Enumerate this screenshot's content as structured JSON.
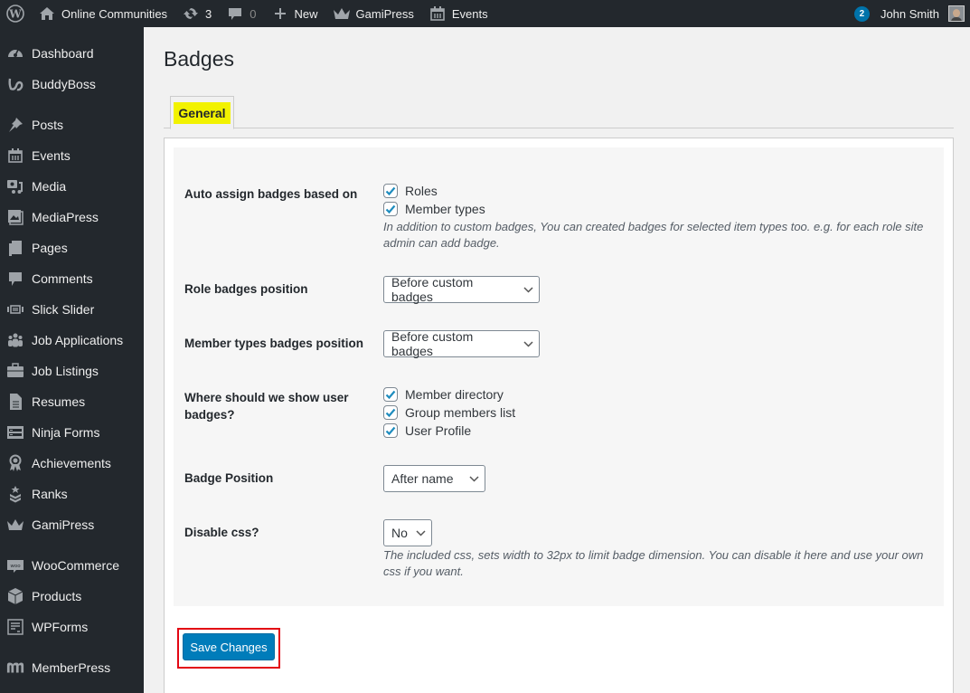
{
  "adminbar": {
    "wp_logo": "wordpress-logo-icon",
    "site_name": "Online Communities",
    "updates_count": "3",
    "comments_count": "0",
    "new_label": "New",
    "gamipress_label": "GamiPress",
    "events_label": "Events",
    "notifications_count": "2",
    "user_name": "John Smith"
  },
  "sidebar": {
    "items": [
      {
        "label": "Dashboard",
        "icon": "dashboard-icon"
      },
      {
        "label": "BuddyBoss",
        "icon": "buddyboss-icon"
      },
      {
        "label": "Posts",
        "icon": "pin-icon"
      },
      {
        "label": "Events",
        "icon": "calendar-icon"
      },
      {
        "label": "Media",
        "icon": "media-icon"
      },
      {
        "label": "MediaPress",
        "icon": "gallery-icon"
      },
      {
        "label": "Pages",
        "icon": "pages-icon"
      },
      {
        "label": "Comments",
        "icon": "comment-icon"
      },
      {
        "label": "Slick Slider",
        "icon": "slider-icon"
      },
      {
        "label": "Job Applications",
        "icon": "groups-icon"
      },
      {
        "label": "Job Listings",
        "icon": "briefcase-icon"
      },
      {
        "label": "Resumes",
        "icon": "document-icon"
      },
      {
        "label": "Ninja Forms",
        "icon": "form-icon"
      },
      {
        "label": "Achievements",
        "icon": "award-icon"
      },
      {
        "label": "Ranks",
        "icon": "rank-icon"
      },
      {
        "label": "GamiPress",
        "icon": "crown-icon"
      },
      {
        "label": "WooCommerce",
        "icon": "woo-icon"
      },
      {
        "label": "Products",
        "icon": "box-icon"
      },
      {
        "label": "WPForms",
        "icon": "wpforms-icon"
      },
      {
        "label": "MemberPress",
        "icon": "memberpress-icon"
      }
    ]
  },
  "page": {
    "title": "Badges",
    "tabs": [
      {
        "label": "General",
        "active": true
      }
    ]
  },
  "settings": {
    "auto_assign": {
      "label": "Auto assign badges based on",
      "options": [
        {
          "label": "Roles",
          "checked": true
        },
        {
          "label": "Member types",
          "checked": true
        }
      ],
      "description": "In addition to custom badges, You can created badges for selected item types too. e.g. for each role site admin can add badge."
    },
    "role_position": {
      "label": "Role badges position",
      "value": "Before custom badges"
    },
    "member_types_position": {
      "label": "Member types badges position",
      "value": "Before custom badges"
    },
    "show_where": {
      "label": "Where should we show user badges?",
      "options": [
        {
          "label": "Member directory",
          "checked": true
        },
        {
          "label": "Group members list",
          "checked": true
        },
        {
          "label": "User Profile",
          "checked": true
        }
      ]
    },
    "badge_position": {
      "label": "Badge Position",
      "value": "After name"
    },
    "disable_css": {
      "label": "Disable css?",
      "value": "No",
      "description": "The included css, sets width to 32px to limit badge dimension. You can disable it here and use your own css if you want."
    }
  },
  "actions": {
    "save_label": "Save Changes"
  },
  "colors": {
    "adminbar_bg": "#23282d",
    "primary_button": "#007cba",
    "tab_highlight": "#f2f200",
    "annotation_box": "#e30613",
    "checkbox_check": "#1e8cbe"
  }
}
